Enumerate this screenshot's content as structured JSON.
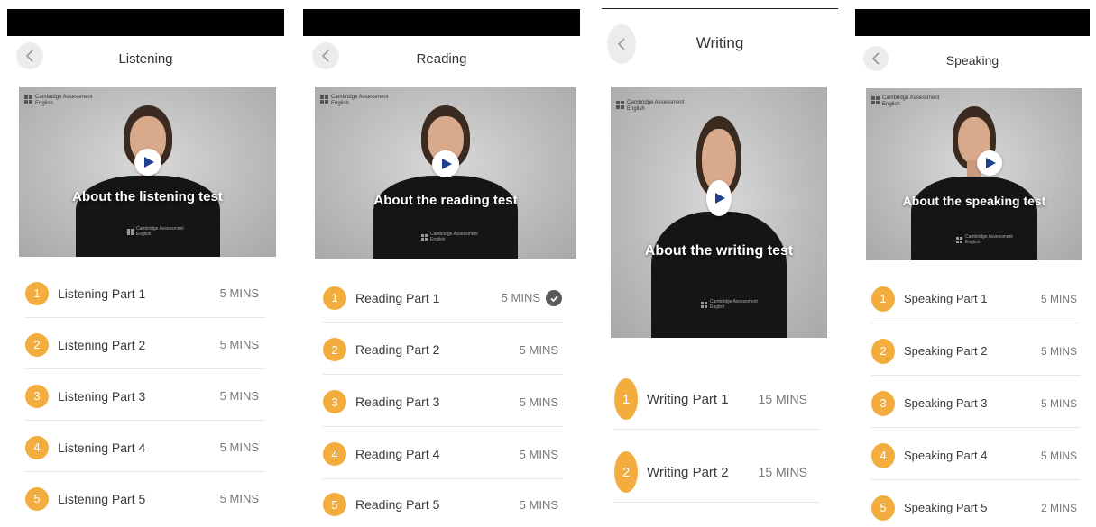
{
  "colors": {
    "accent": "#f2ad3e",
    "status_bar": "#000000",
    "divider": "#e6e6e6",
    "check": "#5b5b5b"
  },
  "icons": {
    "back": "chevron-left-icon",
    "play": "play-icon",
    "completed": "check-circle-icon"
  },
  "screens": [
    {
      "title": "Listening",
      "video": {
        "caption": "About the listening test",
        "brand_line1": "Cambridge Assessment",
        "brand_line2": "English",
        "shirt_line1": "Cambridge Assessment",
        "shirt_line2": "English"
      },
      "parts": [
        {
          "number": "1",
          "label": "Listening Part 1",
          "duration": "5 MINS",
          "completed": false
        },
        {
          "number": "2",
          "label": "Listening Part 2",
          "duration": "5 MINS",
          "completed": false
        },
        {
          "number": "3",
          "label": "Listening Part 3",
          "duration": "5 MINS",
          "completed": false
        },
        {
          "number": "4",
          "label": "Listening Part 4",
          "duration": "5 MINS",
          "completed": false
        },
        {
          "number": "5",
          "label": "Listening Part 5",
          "duration": "5 MINS",
          "completed": false
        }
      ]
    },
    {
      "title": "Reading",
      "video": {
        "caption": "About the reading test",
        "brand_line1": "Cambridge Assessment",
        "brand_line2": "English",
        "shirt_line1": "Cambridge Assessment",
        "shirt_line2": "English"
      },
      "parts": [
        {
          "number": "1",
          "label": "Reading Part 1",
          "duration": "5 MINS",
          "completed": true
        },
        {
          "number": "2",
          "label": "Reading Part 2",
          "duration": "5 MINS",
          "completed": false
        },
        {
          "number": "3",
          "label": "Reading Part 3",
          "duration": "5 MINS",
          "completed": false
        },
        {
          "number": "4",
          "label": "Reading Part 4",
          "duration": "5 MINS",
          "completed": false
        },
        {
          "number": "5",
          "label": "Reading Part 5",
          "duration": "5 MINS",
          "completed": false
        }
      ]
    },
    {
      "title": "Writing",
      "video": {
        "caption": "About the writing test",
        "brand_line1": "Cambridge Assessment",
        "brand_line2": "English",
        "shirt_line1": "Cambridge Assessment",
        "shirt_line2": "English"
      },
      "parts": [
        {
          "number": "1",
          "label": "Writing Part 1",
          "duration": "15 MINS",
          "completed": false
        },
        {
          "number": "2",
          "label": "Writing Part 2",
          "duration": "15 MINS",
          "completed": false
        }
      ]
    },
    {
      "title": "Speaking",
      "video": {
        "caption": "About the speaking test",
        "brand_line1": "Cambridge Assessment",
        "brand_line2": "English",
        "shirt_line1": "Cambridge Assessment",
        "shirt_line2": "English"
      },
      "parts": [
        {
          "number": "1",
          "label": "Speaking Part 1",
          "duration": "5 MINS",
          "completed": false
        },
        {
          "number": "2",
          "label": "Speaking Part 2",
          "duration": "5 MINS",
          "completed": false
        },
        {
          "number": "3",
          "label": "Speaking Part 3",
          "duration": "5 MINS",
          "completed": false
        },
        {
          "number": "4",
          "label": "Speaking Part 4",
          "duration": "5 MINS",
          "completed": false
        },
        {
          "number": "5",
          "label": "Speaking Part 5",
          "duration": "2 MINS",
          "completed": false
        }
      ]
    }
  ]
}
